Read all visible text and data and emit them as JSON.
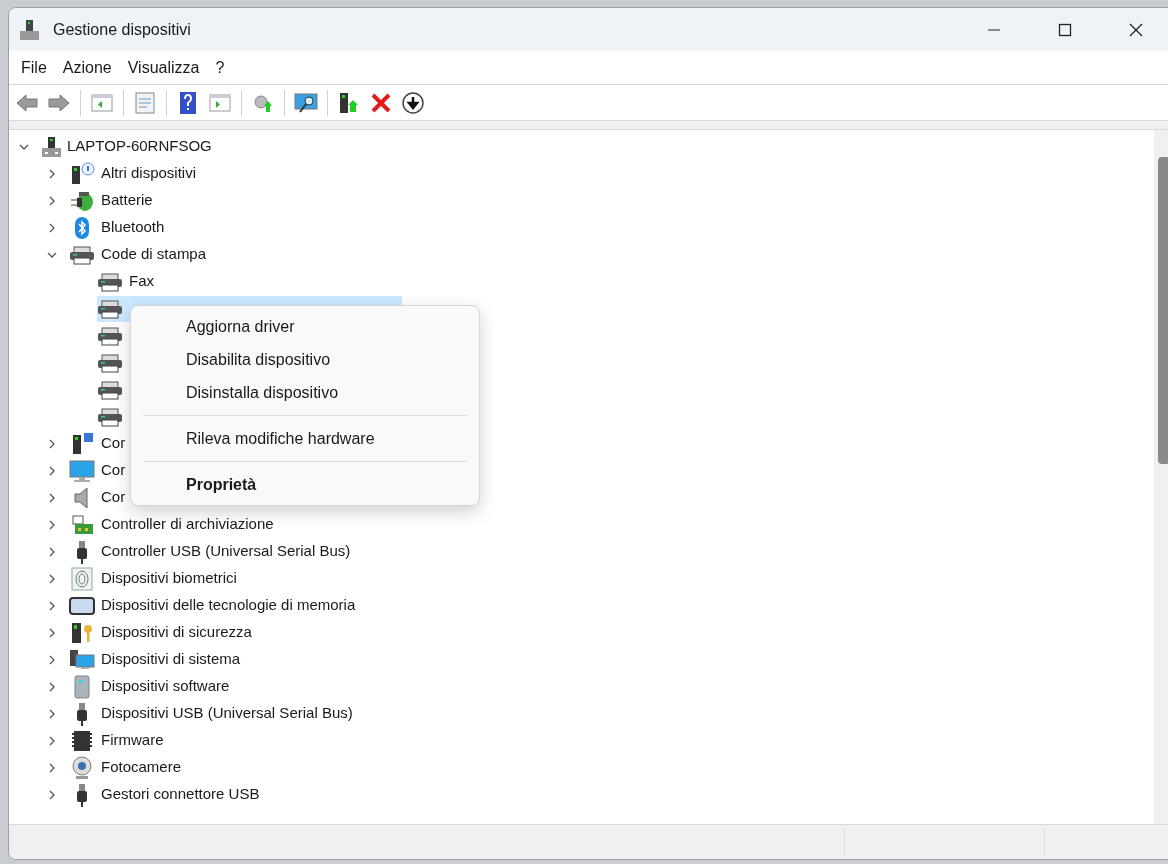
{
  "window": {
    "title": "Gestione dispositivi"
  },
  "menu": [
    "File",
    "Azione",
    "Visualizza",
    "?"
  ],
  "tree": {
    "label": "LAPTOP-60RNFSOG",
    "expanded": true,
    "selected": false,
    "children": [
      {
        "label": "Altri dispositivi",
        "expanded": false,
        "selected": false
      },
      {
        "label": "Batterie",
        "expanded": false,
        "selected": false
      },
      {
        "label": "Bluetooth",
        "expanded": false,
        "selected": false
      },
      {
        "label": "Code di stampa",
        "expanded": true,
        "selected": false,
        "children": [
          {
            "label": "Fax",
            "selected": false
          },
          {
            "selected": true
          },
          {
            "selected": false
          },
          {
            "selected": false
          },
          {
            "selected": false
          },
          {
            "selected": false
          }
        ]
      },
      {
        "label": "Cor",
        "expanded": false,
        "selected": false
      },
      {
        "label": "Cor",
        "expanded": false,
        "selected": false
      },
      {
        "label": "Cor",
        "expanded": false,
        "selected": false
      },
      {
        "label": "Controller di archiviazione",
        "expanded": false,
        "selected": false
      },
      {
        "label": "Controller USB (Universal Serial Bus)",
        "expanded": false,
        "selected": false
      },
      {
        "label": "Dispositivi biometrici",
        "expanded": false,
        "selected": false
      },
      {
        "label": "Dispositivi delle tecnologie di memoria",
        "expanded": false,
        "selected": false
      },
      {
        "label": "Dispositivi di sicurezza",
        "expanded": false,
        "selected": false
      },
      {
        "label": "Dispositivi di sistema",
        "expanded": false,
        "selected": false
      },
      {
        "label": "Dispositivi software",
        "expanded": false,
        "selected": false
      },
      {
        "label": "Dispositivi USB (Universal Serial Bus)",
        "expanded": false,
        "selected": false
      },
      {
        "label": "Firmware",
        "expanded": false,
        "selected": false
      },
      {
        "label": "Fotocamere",
        "expanded": false,
        "selected": false
      },
      {
        "label": "Gestori connettore USB",
        "expanded": false,
        "selected": false
      }
    ]
  },
  "context_menu": {
    "items": [
      {
        "kind": "item",
        "label": "Aggiorna driver",
        "default": false
      },
      {
        "kind": "item",
        "label": "Disabilita dispositivo",
        "default": false
      },
      {
        "kind": "item",
        "label": "Disinstalla dispositivo",
        "default": false
      },
      {
        "kind": "separator"
      },
      {
        "kind": "item",
        "label": "Rileva modifiche hardware",
        "default": false
      },
      {
        "kind": "separator"
      },
      {
        "kind": "item",
        "label": "Proprietà",
        "default": true
      }
    ]
  }
}
